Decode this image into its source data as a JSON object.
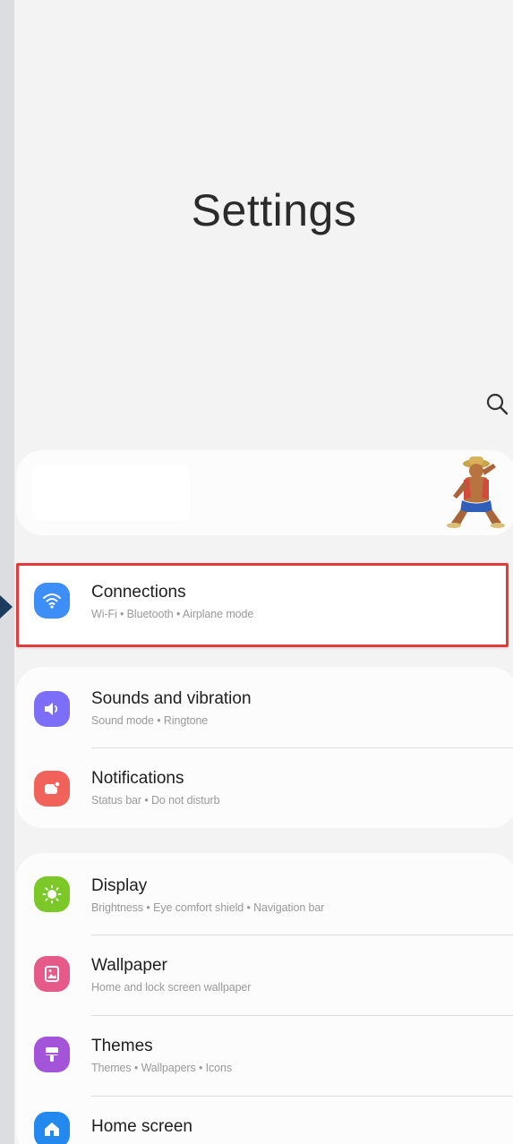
{
  "header": {
    "title": "Settings"
  },
  "icons": {
    "search": "search-icon",
    "avatar": "account-avatar"
  },
  "connections": {
    "title": "Connections",
    "subtitle": "Wi-Fi  •  Bluetooth  •  Airplane mode",
    "icon": "wifi-icon",
    "color": "#3d8ef7"
  },
  "group1": [
    {
      "title": "Sounds and vibration",
      "subtitle": "Sound mode  •  Ringtone",
      "icon": "volume-icon",
      "color": "#7c6ef6"
    },
    {
      "title": "Notifications",
      "subtitle": "Status bar  •  Do not disturb",
      "icon": "notification-icon",
      "color": "#f0625a"
    }
  ],
  "group2": [
    {
      "title": "Display",
      "subtitle": "Brightness  •  Eye comfort shield  •  Navigation bar",
      "icon": "brightness-icon",
      "color": "#7cc828"
    },
    {
      "title": "Wallpaper",
      "subtitle": "Home and lock screen wallpaper",
      "icon": "image-icon",
      "color": "#e65a8a"
    },
    {
      "title": "Themes",
      "subtitle": "Themes  •  Wallpapers  •  Icons",
      "icon": "theme-icon",
      "color": "#a354d8"
    },
    {
      "title": "Home screen",
      "subtitle": "",
      "icon": "home-icon",
      "color": "#2489ef"
    }
  ]
}
